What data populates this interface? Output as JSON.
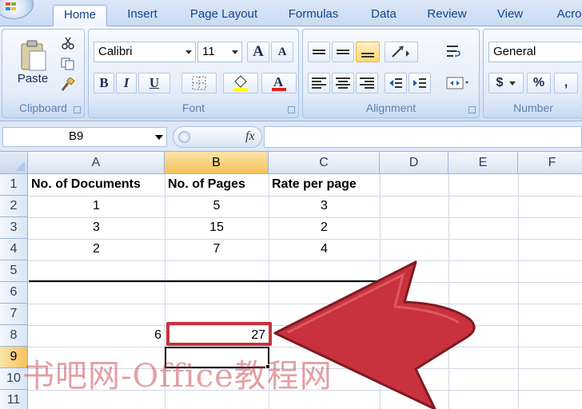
{
  "ribbon_tabs": [
    "Home",
    "Insert",
    "Page Layout",
    "Formulas",
    "Data",
    "Review",
    "View",
    "Acro"
  ],
  "clipboard": {
    "paste_label": "Paste",
    "group_label": "Clipboard"
  },
  "font": {
    "name": "Calibri",
    "size": "11",
    "group_label": "Font",
    "bold": "B",
    "italic": "I",
    "underline": "U",
    "grow": "A",
    "shrink": "A"
  },
  "alignment": {
    "group_label": "Alignment"
  },
  "number": {
    "format": "General",
    "group_label": "Number",
    "currency": "$",
    "percent": "%",
    "comma": ","
  },
  "formula_bar": {
    "name_box": "B9",
    "fx": "fx"
  },
  "columns": [
    "A",
    "B",
    "C",
    "D",
    "E",
    "F"
  ],
  "rows": [
    "1",
    "2",
    "3",
    "4",
    "5",
    "6",
    "7",
    "8",
    "9",
    "10",
    "11"
  ],
  "cells": {
    "A1": "No. of Documents",
    "B1": "No. of Pages",
    "C1": "Rate per page",
    "A2": "1",
    "B2": "5",
    "C2": "3",
    "A3": "3",
    "B3": "15",
    "C3": "2",
    "A4": "2",
    "B4": "7",
    "C4": "4",
    "A8": "6",
    "B8": "27"
  },
  "selected_cell": "B9",
  "watermark": "书吧网-Office教程网",
  "colors": {
    "callout_red": "#c4333f",
    "selection_orange": "#f6c25c",
    "header_text": "#15428b"
  }
}
